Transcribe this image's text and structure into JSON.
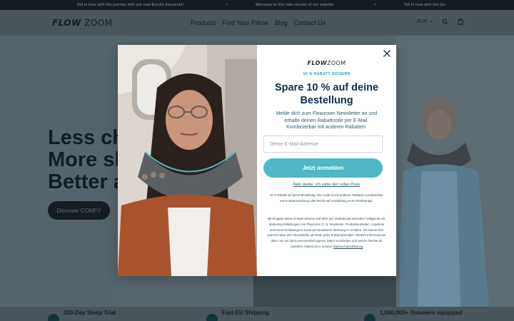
{
  "announcement": {
    "msg1": "Fall in love with the journey with our new Bundle discounts!",
    "msg2": "Welcome to this new version of our website",
    "msg3": "Fall in love with the jou",
    "divider": "•"
  },
  "header": {
    "logo_flow": "FLOW",
    "logo_zoom": "ZOOM",
    "nav": [
      "Products",
      "Find Your Pillow",
      "Blog",
      "Contact Us"
    ],
    "currency": "EUR"
  },
  "hero": {
    "title_lines": [
      "Less ch",
      "More sl",
      "Better a"
    ],
    "cta": "Discover COMFY"
  },
  "usp": {
    "item1": "100-Day Sleep Trial",
    "item2": "Fast EU Shipping",
    "item3": "1,000,000+ Travelers equipped"
  },
  "modal": {
    "logo_flow": "FLOW",
    "logo_zoom": "ZOOM",
    "eyebrow": "10 % RABATT SICHERN",
    "title": "Spare 10 % auf deine Bestellung",
    "description": "Melde dich zum Flowzoom Newsletter an und erhalte deinen Rabattcode per E-Mail. Kombinierbar mit anderen Rabatten.",
    "email_placeholder": "Deine E-Mail-Adresse",
    "submit_label": "Jetzt anmelden",
    "decline_label": "Nein danke, ich zahle den vollen Preis",
    "fine_print_1": "10 % Rabatt auf deine Bestellung. Der Code ist mit anderen Rabatten kombinierbar. Keine Barauszahlung oder Recht auf Auszahlung eines Restbetrags.",
    "fine_print_2": "Mit Eingabe deiner E-Mail-Adresse und Klick auf „Rabattcode anfordern\" willigst du ein, Marketing-Mitteilungen von Flowzoom (z. B. Newsletter, Produktneuheiten, Angebote und Event-Einladungen) sowie personalisierte Werbung zu erhalten. Du kannst dich jederzeit über den Abmeldelink am Ende jeder E-Mail abmelden. Weitere Informationen dazu, wie wir deine personenbezogenen Daten verarbeiten und welche Rechte dir zustehen, findest du in unserer",
    "privacy_link": "Datenschutzerklärung"
  },
  "colors": {
    "accent": "#4fb8c7",
    "headline": "#10304a",
    "overlay": "#58666e"
  }
}
